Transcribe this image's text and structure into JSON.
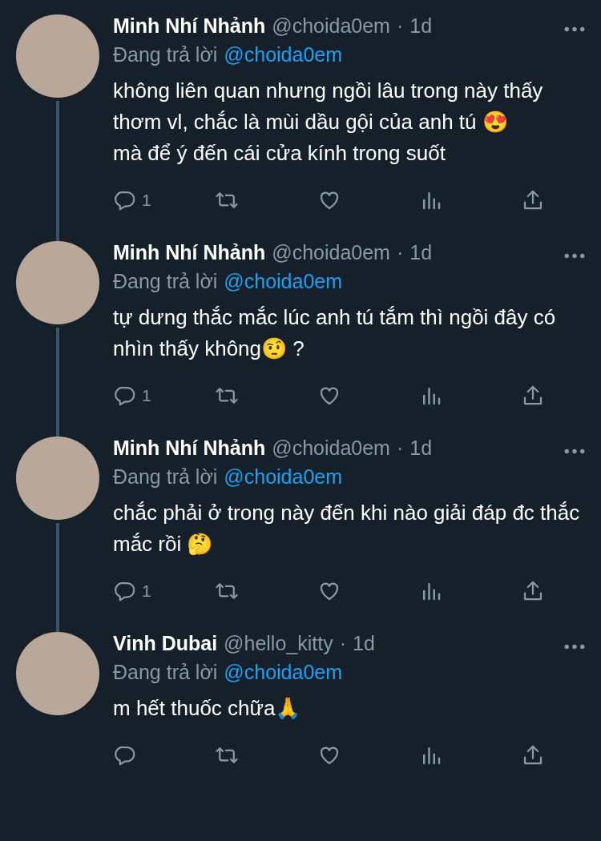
{
  "tweets": [
    {
      "name": "Minh Nhí Nhảnh",
      "handle": "@choida0em",
      "separator": "·",
      "time": "1d",
      "reply_prefix": "Đang trả lời",
      "reply_to": "@choida0em",
      "paragraphs": [
        "không liên quan nhưng ngồi lâu trong này thấy thơm vl, chắc là mùi dầu gội của anh tú 😍",
        "mà để ý đến cái cửa kính trong suốt"
      ],
      "reply_count": "1"
    },
    {
      "name": "Minh Nhí Nhảnh",
      "handle": "@choida0em",
      "separator": "·",
      "time": "1d",
      "reply_prefix": "Đang trả lời",
      "reply_to": "@choida0em",
      "paragraphs": [
        "tự dưng thắc mắc lúc anh tú tắm thì ngồi đây có nhìn thấy không🤨 ?"
      ],
      "reply_count": "1"
    },
    {
      "name": "Minh Nhí Nhảnh",
      "handle": "@choida0em",
      "separator": "·",
      "time": "1d",
      "reply_prefix": "Đang trả lời",
      "reply_to": "@choida0em",
      "paragraphs": [
        "chắc phải ở trong này đến khi nào giải đáp đc thắc mắc rồi 🤔"
      ],
      "reply_count": "1"
    },
    {
      "name": "Vinh Dubai",
      "handle": "@hello_kitty",
      "separator": "·",
      "time": "1d",
      "reply_prefix": "Đang trả lời",
      "reply_to": "@choida0em",
      "paragraphs": [
        "m hết thuốc chữa🙏"
      ]
    }
  ]
}
